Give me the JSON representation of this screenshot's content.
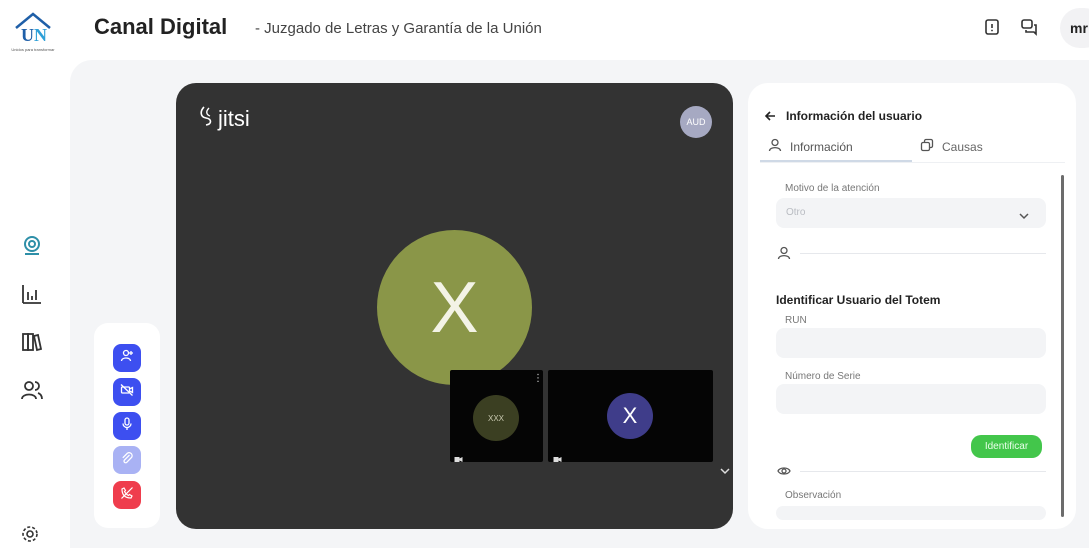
{
  "header": {
    "logo_caption": "Unidos para transformar",
    "title": "Canal Digital",
    "subtitle": "- Juzgado de Letras y Garantía de la Unión",
    "user_initials": "mr"
  },
  "video": {
    "brand": "jitsi",
    "aud_badge": "AUD",
    "main_participant_initial": "X",
    "thumb1_label": "XXX",
    "thumb2_initial": "X"
  },
  "panel": {
    "title": "Información del usuario",
    "tabs": [
      {
        "label": "Información",
        "active": true
      },
      {
        "label": "Causas",
        "active": false
      }
    ],
    "motivo_label": "Motivo de la atención",
    "motivo_value": "Otro",
    "identify_title": "Identificar Usuario del Totem",
    "run_label": "RUN",
    "serie_label": "Número de Serie",
    "identify_button": "Identificar",
    "observacion_label": "Observación"
  },
  "colors": {
    "control_blue": "#3d4ff0",
    "control_blue_light": "#a9b2f4",
    "control_red": "#ef3d4d",
    "identify_green": "#43c64b",
    "main_avatar": "#8a9648",
    "sidebar_active": "#2e8fa8"
  },
  "icons": {
    "sidebar": [
      "webcam-icon",
      "bar-chart-icon",
      "books-icon",
      "users-icon",
      "settings-icon"
    ],
    "header": [
      "report-icon",
      "chat-icon"
    ],
    "controls": [
      "add-user-icon",
      "camera-off-icon",
      "microphone-icon",
      "attachment-icon",
      "hangup-icon"
    ]
  }
}
